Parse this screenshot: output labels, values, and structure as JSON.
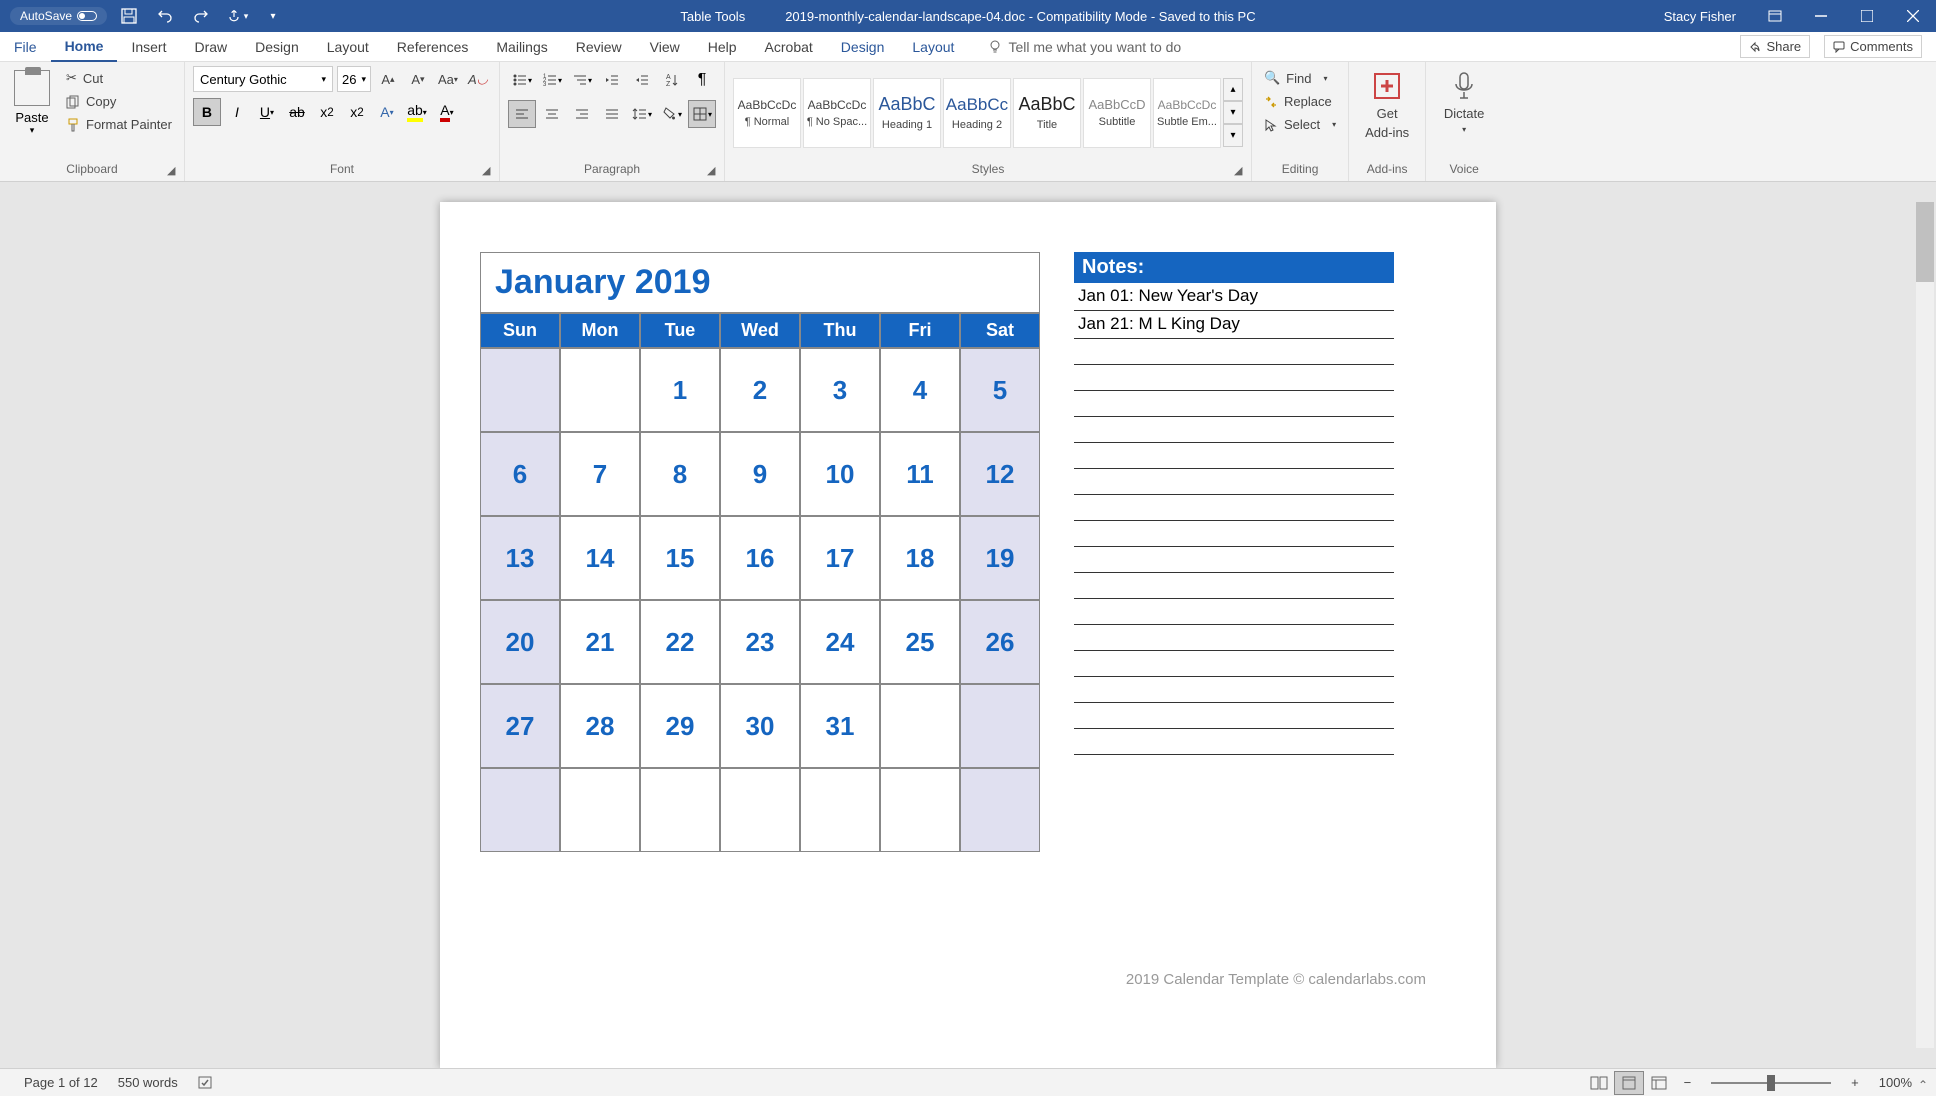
{
  "titlebar": {
    "autosave_label": "AutoSave",
    "table_tools": "Table Tools",
    "doc_title": "2019-monthly-calendar-landscape-04.doc  -  Compatibility Mode  -  Saved to this PC",
    "user": "Stacy Fisher"
  },
  "tabs": {
    "file": "File",
    "home": "Home",
    "insert": "Insert",
    "draw": "Draw",
    "design": "Design",
    "layout": "Layout",
    "references": "References",
    "mailings": "Mailings",
    "review": "Review",
    "view": "View",
    "help": "Help",
    "acrobat": "Acrobat",
    "tt_design": "Design",
    "tt_layout": "Layout",
    "tell_me": "Tell me what you want to do",
    "share": "Share",
    "comments": "Comments"
  },
  "ribbon": {
    "clipboard": {
      "paste": "Paste",
      "cut": "Cut",
      "copy": "Copy",
      "format_painter": "Format Painter",
      "label": "Clipboard"
    },
    "font": {
      "name": "Century Gothic",
      "size": "26",
      "label": "Font"
    },
    "paragraph": {
      "label": "Paragraph"
    },
    "styles": {
      "items": [
        {
          "preview": "AaBbCcDc",
          "label": "¶ Normal"
        },
        {
          "preview": "AaBbCcDc",
          "label": "¶ No Spac..."
        },
        {
          "preview": "AaBbC",
          "label": "Heading 1"
        },
        {
          "preview": "AaBbCc",
          "label": "Heading 2"
        },
        {
          "preview": "AaBbC",
          "label": "Title"
        },
        {
          "preview": "AaBbCcD",
          "label": "Subtitle"
        },
        {
          "preview": "AaBbCcDc",
          "label": "Subtle Em..."
        }
      ],
      "label": "Styles"
    },
    "editing": {
      "find": "Find",
      "replace": "Replace",
      "select": "Select",
      "label": "Editing"
    },
    "addins": {
      "get": "Get",
      "addins": "Add-ins",
      "label": "Add-ins"
    },
    "voice": {
      "dictate": "Dictate",
      "label": "Voice"
    }
  },
  "calendar": {
    "title": "January 2019",
    "days": [
      "Sun",
      "Mon",
      "Tue",
      "Wed",
      "Thu",
      "Fri",
      "Sat"
    ],
    "weeks": [
      [
        "",
        "",
        "1",
        "2",
        "3",
        "4",
        "5"
      ],
      [
        "6",
        "7",
        "8",
        "9",
        "10",
        "11",
        "12"
      ],
      [
        "13",
        "14",
        "15",
        "16",
        "17",
        "18",
        "19"
      ],
      [
        "20",
        "21",
        "22",
        "23",
        "24",
        "25",
        "26"
      ],
      [
        "27",
        "28",
        "29",
        "30",
        "31",
        "",
        ""
      ],
      [
        "",
        "",
        "",
        "",
        "",
        "",
        ""
      ]
    ]
  },
  "notes": {
    "header": "Notes:",
    "entries": [
      "Jan 01: New Year's Day",
      "Jan 21: M L King Day"
    ],
    "blank_lines": 16
  },
  "footer": "2019 Calendar Template © calendarlabs.com",
  "statusbar": {
    "page": "Page 1 of 12",
    "words": "550 words",
    "zoom": "100%"
  }
}
